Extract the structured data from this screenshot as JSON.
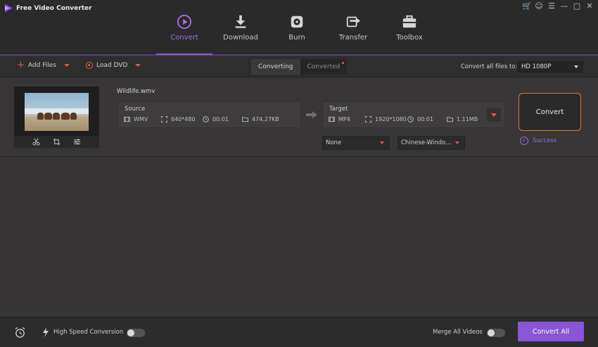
{
  "app": {
    "title": "Free Video Converter"
  },
  "colors": {
    "accent": "#8a55d8",
    "warn": "#e5594b",
    "convert_border": "#d97a3a"
  },
  "nav": {
    "items": [
      {
        "label": "Convert",
        "icon": "play-circle-icon",
        "active": true
      },
      {
        "label": "Download",
        "icon": "download-icon"
      },
      {
        "label": "Burn",
        "icon": "disc-burn-icon"
      },
      {
        "label": "Transfer",
        "icon": "transfer-icon"
      },
      {
        "label": "Toolbox",
        "icon": "toolbox-icon"
      }
    ]
  },
  "toolbar": {
    "add_files": "Add Files",
    "load_dvd": "Load DVD",
    "tab_converting": "Converting",
    "tab_converted": "Converted",
    "convert_all_to_label": "Convert all files to:",
    "format_value": "HD 1080P"
  },
  "file": {
    "name": "Wildlife.wmv",
    "source": {
      "title": "Source",
      "format": "WMV",
      "resolution": "640*480",
      "duration": "00:01",
      "size": "474.27KB"
    },
    "target": {
      "title": "Target",
      "format": "MP4",
      "resolution": "1920*1080",
      "duration": "00:01",
      "size": "1.11MB"
    },
    "subtitle_select": "None",
    "audio_select": "Chinese-Windo...",
    "convert_label": "Convert",
    "status": "Success"
  },
  "bottom": {
    "high_speed_label": "High Speed Conversion",
    "merge_label": "Merge All Videos",
    "convert_all_label": "Convert All"
  }
}
